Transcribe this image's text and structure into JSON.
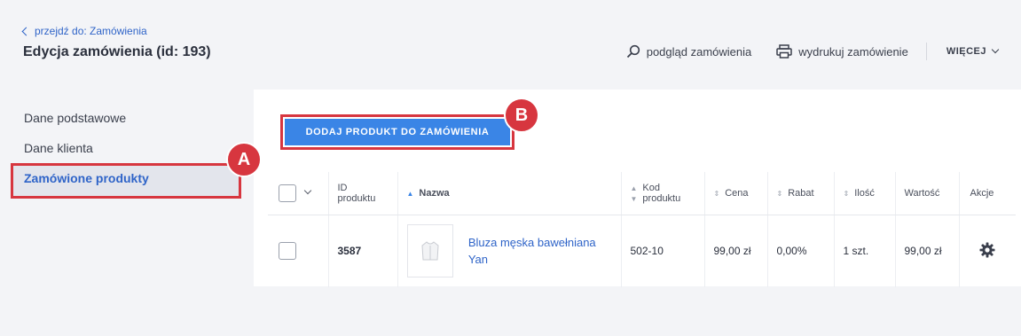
{
  "header": {
    "back_link": "przejdź do: Zamówienia",
    "title": "Edycja zamówienia (id: 193)",
    "preview_label": "podgląd zamówienia",
    "print_label": "wydrukuj zamówienie",
    "more_label": "WIĘCEJ"
  },
  "sidebar": {
    "items": [
      {
        "label": "Dane podstawowe"
      },
      {
        "label": "Dane klienta"
      },
      {
        "label": "Zamówione produkty"
      }
    ]
  },
  "annotations": {
    "a": "A",
    "b": "B"
  },
  "main": {
    "add_button": "DODAJ PRODUKT DO ZAMÓWIENIA",
    "columns": {
      "id_line1": "ID",
      "id_line2": "produktu",
      "name": "Nazwa",
      "code_line1": "Kod",
      "code_line2": "produktu",
      "price": "Cena",
      "discount": "Rabat",
      "qty": "Ilość",
      "value": "Wartość",
      "actions": "Akcje"
    },
    "rows": [
      {
        "id": "3587",
        "name": "Bluza męska bawełniana Yan",
        "code": "502-10",
        "price": "99,00 zł",
        "discount": "0,00%",
        "qty": "1 szt.",
        "value": "99,00 zł"
      }
    ]
  },
  "colors": {
    "accent": "#3a85e6",
    "link": "#2f64c8",
    "highlight": "#d7363f",
    "background": "#f3f4f7"
  }
}
